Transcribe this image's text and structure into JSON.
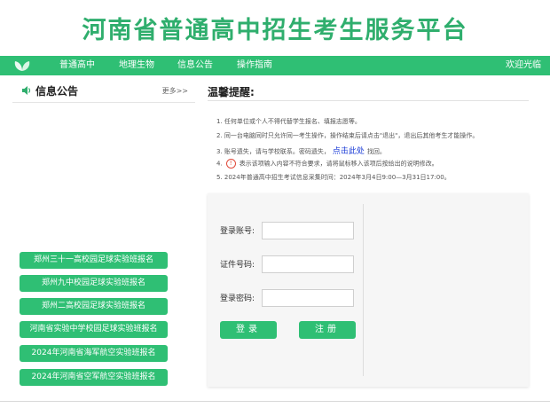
{
  "header": {
    "site_title": "河南省普通高中招生考生服务平台"
  },
  "nav": {
    "items": [
      {
        "label": "普通高中"
      },
      {
        "label": "地理生物"
      },
      {
        "label": "信息公告"
      },
      {
        "label": "操作指南"
      }
    ],
    "welcome": "欢迎光临"
  },
  "news": {
    "title": "信息公告",
    "more": "更多>>",
    "buttons": [
      {
        "label": "郑州三十一高校园足球实验班报名"
      },
      {
        "label": "郑州九中校园足球实验班报名"
      },
      {
        "label": "郑州二高校园足球实验班报名"
      },
      {
        "label": "河南省实验中学校园足球实验班报名"
      },
      {
        "label": "2024年河南省海军航空实验班报名"
      },
      {
        "label": "2024年河南省空军航空实验班报名"
      }
    ]
  },
  "tips": {
    "title": "温馨提醒:",
    "items": [
      "1. 任何单位或个人不得代替学生报名、填报志愿等。",
      "2. 同一台电脑同时只允许同一考生操作，操作结束后请点击\"退出\"，退出后其他考生才能操作。",
      "3. 账号遗失，请与学校联系。密码遗失，",
      "4.",
      "5. 2024年普通高中招生考试信息采集时间：2024年3月4日9:00—3月31日17:00。"
    ],
    "tip3_link": "点击此处",
    "tip3_suffix": "找回。",
    "tip4_suffix": "表示该项输入内容不符合要求，请将鼠标移入该项后按给出的说明修改。",
    "warn_symbol": "!"
  },
  "login": {
    "account_label": "登录账号:",
    "id_label": "证件号码:",
    "password_label": "登录密码:",
    "account_value": "",
    "id_value": "",
    "password_value": "",
    "login_button": "登录",
    "register_button": "注册"
  },
  "colors": {
    "brand_green": "#2fbf74",
    "title_green": "#2fae6d",
    "link_blue": "#1a3bd6",
    "warn_red": "#e04a3a"
  }
}
